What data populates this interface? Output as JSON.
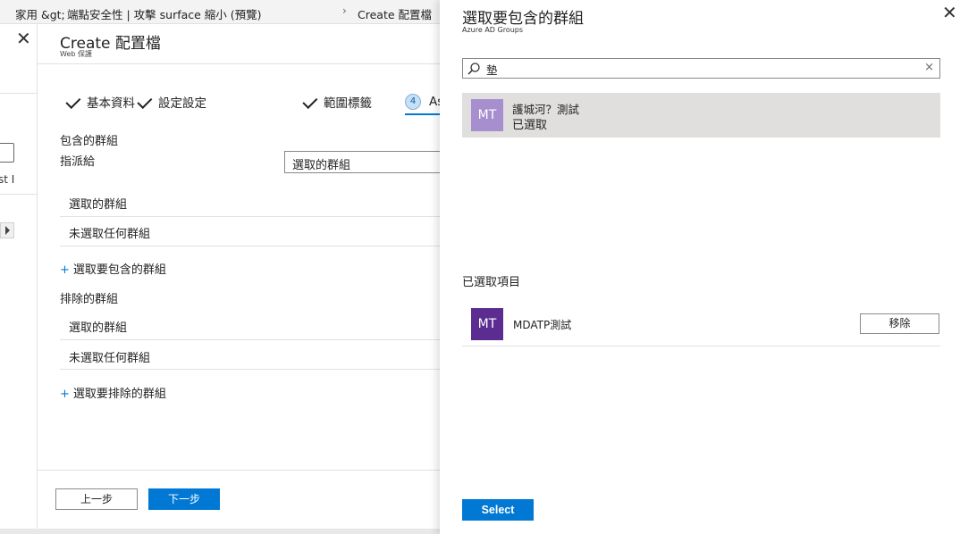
{
  "breadcrumb": {
    "home": "家用 &gt;",
    "security": "端點安全性 | 攻擊 surface 縮小 (預覽)",
    "current": "Create 配置檔"
  },
  "left_strip": {
    "partial_text": "st I"
  },
  "profile": {
    "title": "Create 配置檔",
    "subtitle": "Web 保護"
  },
  "steps": [
    {
      "label": "基本資料"
    },
    {
      "label": "設定設定"
    },
    {
      "label": "範圍標籤"
    },
    {
      "number": "4",
      "label": "As"
    }
  ],
  "included": {
    "heading": "包含的群組",
    "assign_label": "指派給",
    "assign_value": "選取的群組",
    "col_header": "選取的群組",
    "empty_text": "未選取任何群組",
    "add_link": "選取要包含的群組"
  },
  "excluded": {
    "heading": "排除的群組",
    "col_header": "選取的群組",
    "empty_text": "未選取任何群組",
    "add_link": "選取要排除的群組"
  },
  "footer": {
    "back": "上一步",
    "next": "下一步"
  },
  "pane": {
    "title": "選取要包含的群組",
    "subtitle": "Azure AD Groups",
    "search_value": "墊",
    "search_clear": "×",
    "result": {
      "initials": "MT",
      "name": "護城河？測試",
      "state": "已選取"
    },
    "selected_heading": "已選取項目",
    "selected_items": [
      {
        "initials": "MT",
        "name": "MDATP測試",
        "remove": "移除"
      }
    ],
    "select_button": "Select"
  },
  "colors": {
    "accent": "#0078d4",
    "avatar_light": "#a78fcf",
    "avatar_dark": "#5c2d91",
    "result_bg": "#e1dfdd"
  }
}
